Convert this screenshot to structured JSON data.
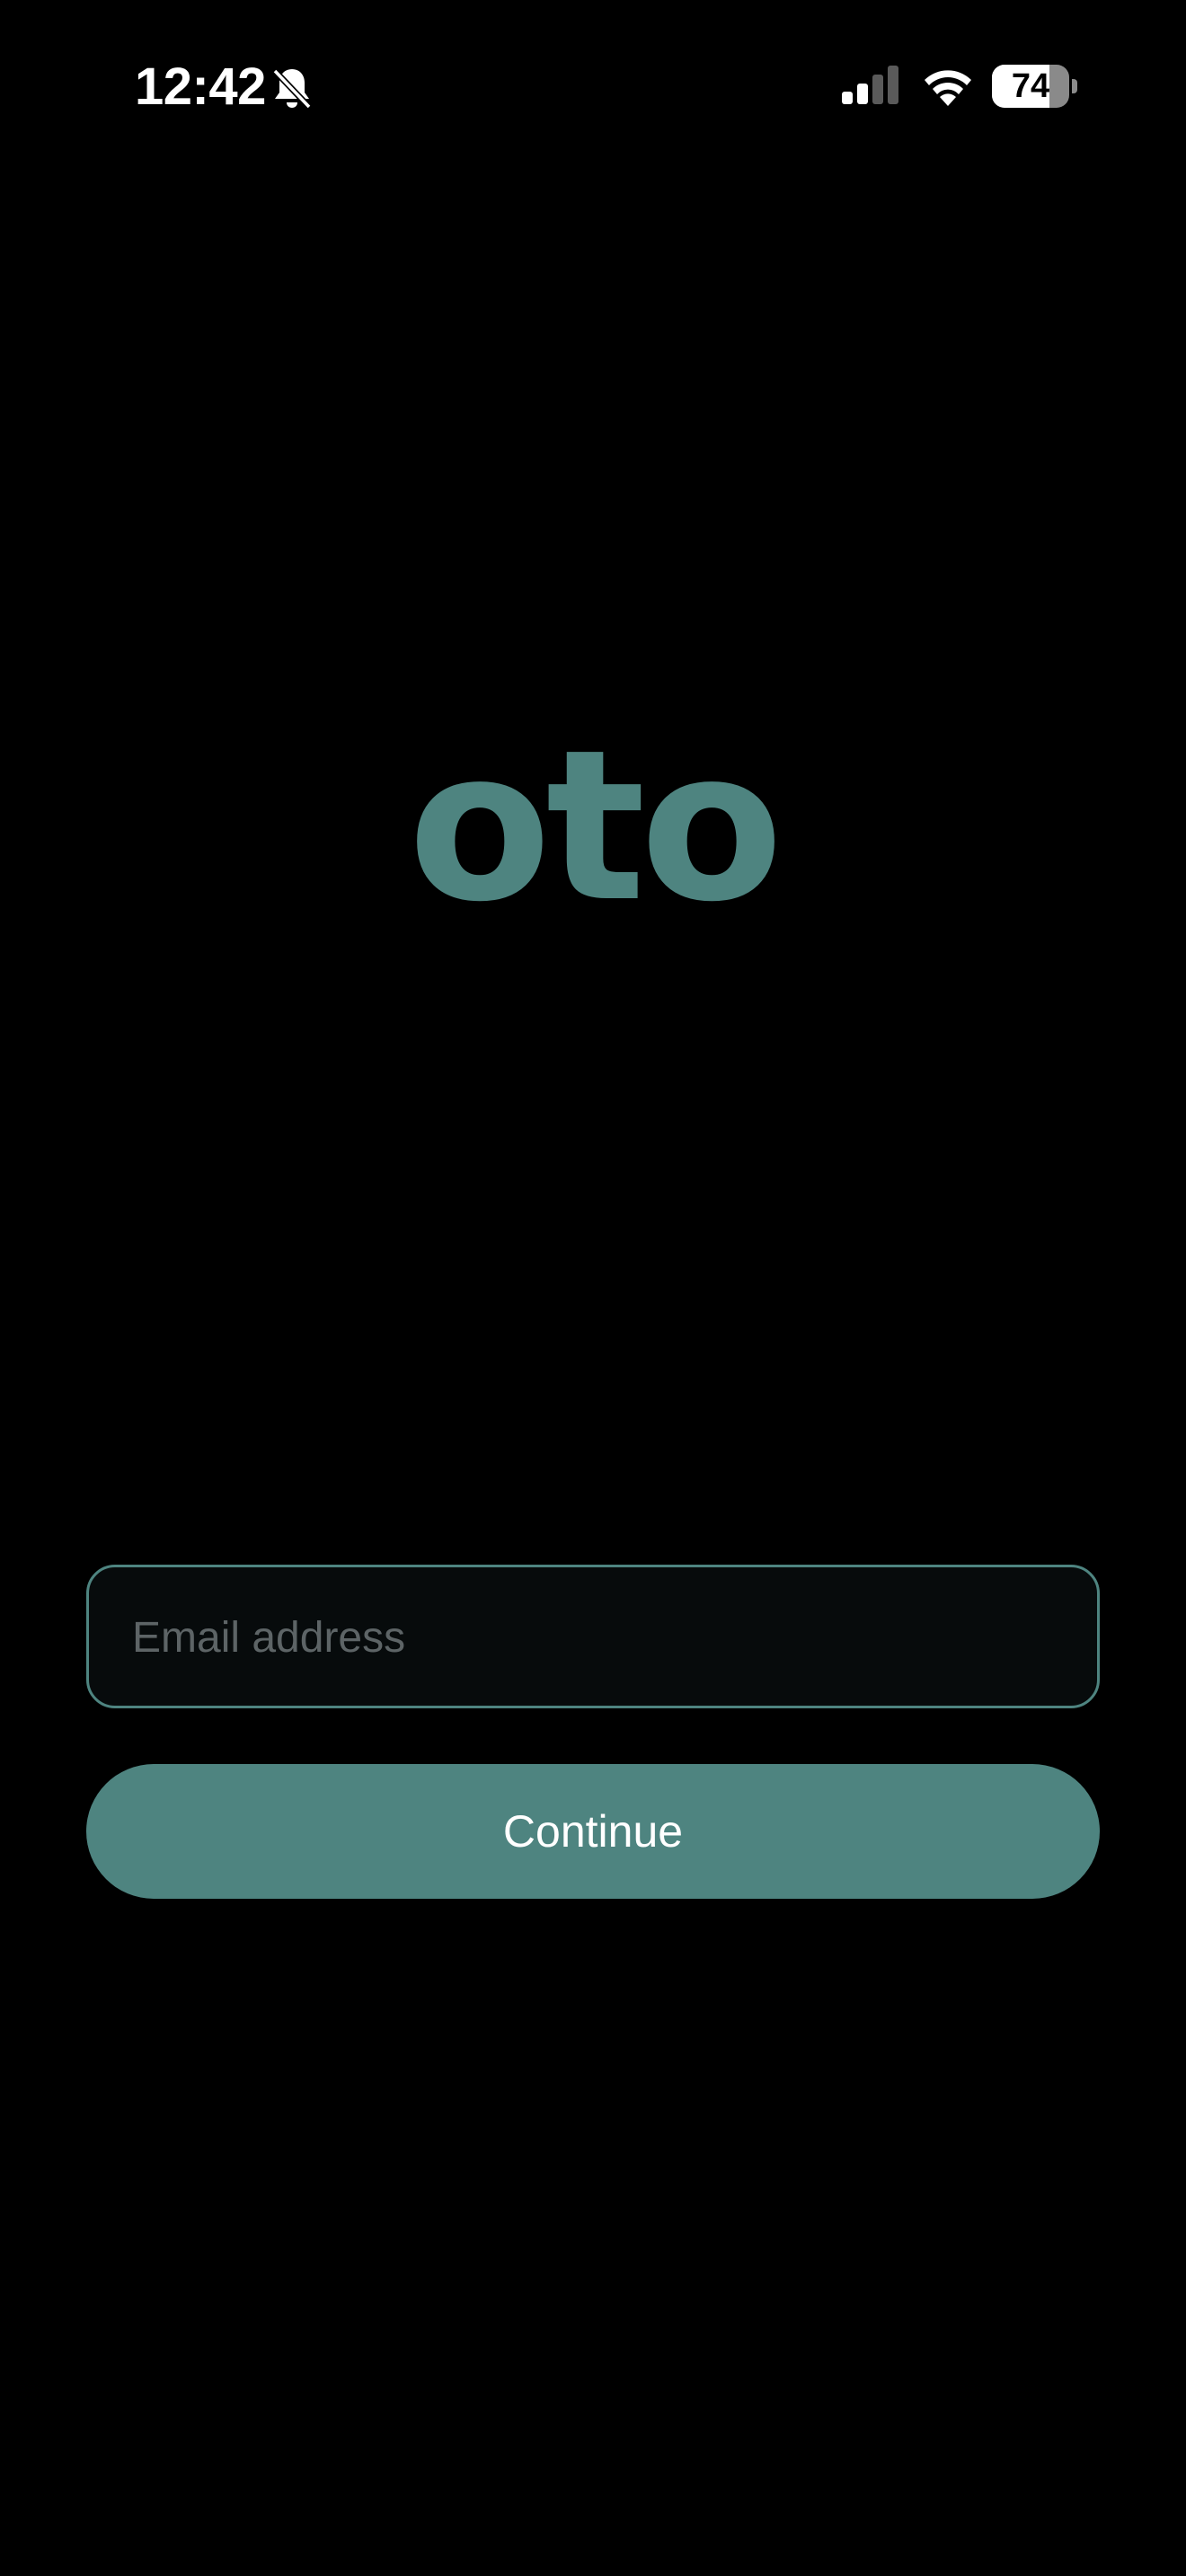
{
  "status_bar": {
    "time": "12:42",
    "silent_icon": "bell-slash-icon",
    "signal_icon": "cellular-signal-icon",
    "wifi_icon": "wifi-icon",
    "battery_level": "74",
    "battery_fraction": 0.74
  },
  "brand": {
    "logo_text": "oto",
    "accent_color": "#4e8480"
  },
  "login": {
    "email_value": "",
    "email_placeholder": "Email address",
    "continue_label": "Continue"
  }
}
